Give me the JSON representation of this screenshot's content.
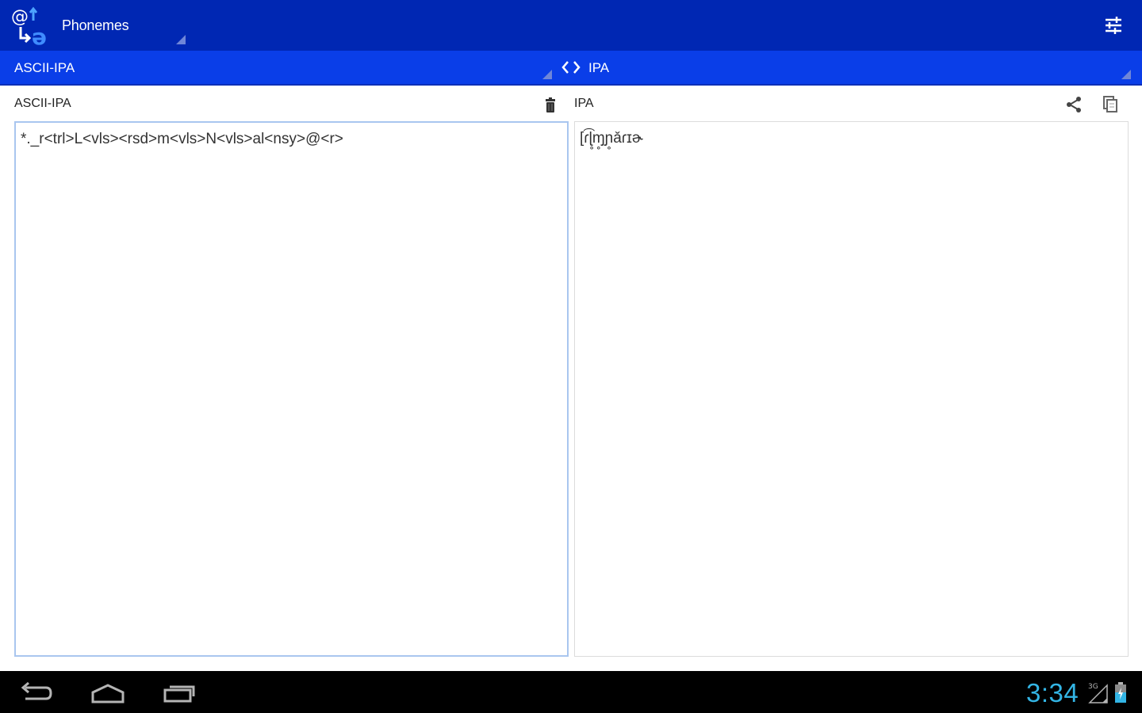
{
  "action_bar": {
    "title": "Phonemes",
    "icons": {
      "app": "app-logo-icon",
      "settings": "sliders-icon"
    }
  },
  "conversion_bar": {
    "from": "ASCII-IPA",
    "to": "IPA",
    "icons": {
      "swap": "swap-arrows-icon"
    }
  },
  "input_panel": {
    "label": "ASCII-IPA",
    "text": "*._r<trl>L<vls><rsd>m<vls>N<vls>al<nsy>@<r>",
    "icons": {
      "clear": "trash-icon"
    }
  },
  "output_panel": {
    "label": "IPA",
    "text": "[ɾ͡ɭ̥ɱ̥ɲ̥ǎɾɪɚ",
    "icons": {
      "share": "share-icon",
      "copy": "copy-icon"
    }
  },
  "system_bar": {
    "clock": "3:34",
    "network_badge": "3G",
    "icons": {
      "back": "back-icon",
      "home": "home-icon",
      "recents": "recent-apps-icon",
      "signal": "signal-icon",
      "battery": "battery-icon"
    }
  },
  "colors": {
    "action_bar": "#0027b3",
    "conversion_bar": "#0a3ee8",
    "accent": "#33b5e5",
    "input_focus_border": "#a9c6ef"
  }
}
